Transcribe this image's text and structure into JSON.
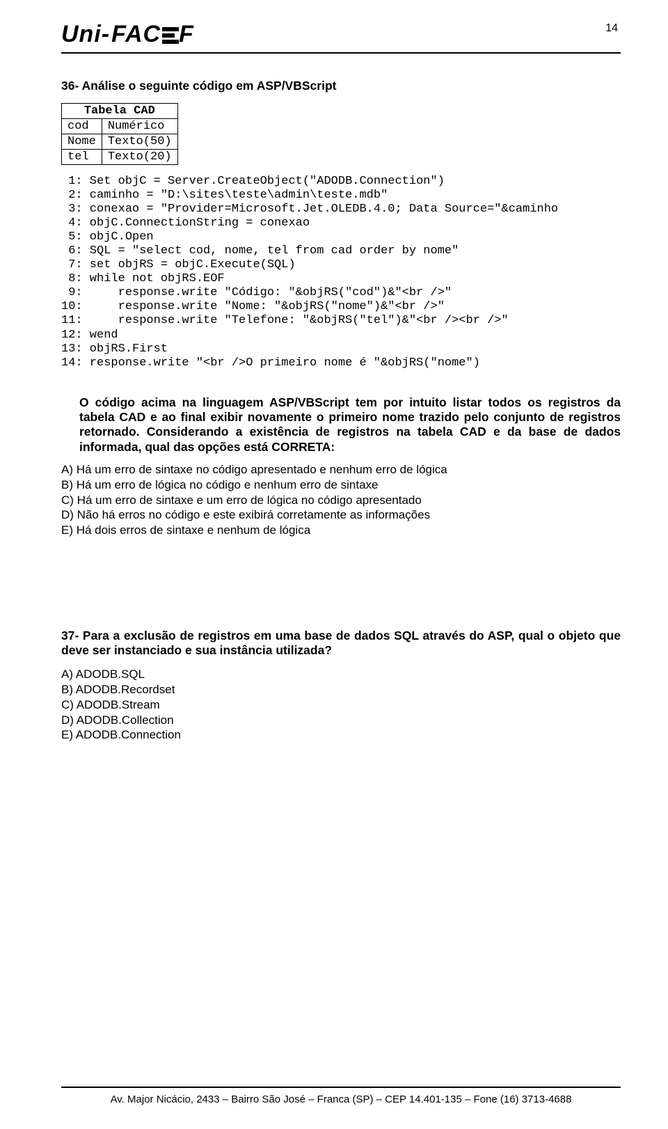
{
  "page_number": "14",
  "logo": {
    "part1": "Uni-",
    "part2": "FAC",
    "part3": "F"
  },
  "q36": {
    "title": "36- Análise o seguinte código em ASP/VBScript",
    "table": {
      "header": "Tabela CAD",
      "rows": [
        {
          "c1": "cod",
          "c2": "Numérico"
        },
        {
          "c1": "Nome",
          "c2": "Texto(50)"
        },
        {
          "c1": "tel",
          "c2": "Texto(20)"
        }
      ]
    },
    "code_lines": [
      " 1: Set objC = Server.CreateObject(\"ADODB.Connection\")",
      " 2: caminho = \"D:\\sites\\teste\\admin\\teste.mdb\"",
      " 3: conexao = \"Provider=Microsoft.Jet.OLEDB.4.0; Data Source=\"&caminho",
      " 4: objC.ConnectionString = conexao",
      " 5: objC.Open",
      " 6: SQL = \"select cod, nome, tel from cad order by nome\"",
      " 7: set objRS = objC.Execute(SQL)",
      " 8: while not objRS.EOF",
      " 9:     response.write \"Código: \"&objRS(\"cod\")&\"<br />\"",
      "10:     response.write \"Nome: \"&objRS(\"nome\")&\"<br />\"",
      "11:     response.write \"Telefone: \"&objRS(\"tel\")&\"<br /><br />\"",
      "12: wend",
      "13: objRS.First",
      "14: response.write \"<br />O primeiro nome é \"&objRS(\"nome\")"
    ],
    "desc": "O código acima na linguagem ASP/VBScript tem por intuito listar todos os registros da tabela CAD e ao final exibir novamente o primeiro nome trazido pelo conjunto de registros retornado. Considerando a existência de registros na tabela CAD e da base de dados informada, qual das opções está CORRETA:",
    "options": [
      "A)  Há um erro de sintaxe no código apresentado e nenhum erro de lógica",
      "B)  Há um erro de lógica no código e nenhum erro de sintaxe",
      "C)  Há um erro de sintaxe e um erro de lógica no código apresentado",
      "D)  Não há erros no código e este exibirá corretamente as informações",
      "E)  Há dois erros de sintaxe e nenhum de lógica"
    ]
  },
  "q37": {
    "title": "37- Para a exclusão de registros em uma base de dados SQL através do ASP, qual o objeto que deve ser instanciado e sua instância utilizada?",
    "options": [
      "A)  ADODB.SQL",
      "B)  ADODB.Recordset",
      "C)  ADODB.Stream",
      "D)  ADODB.Collection",
      "E)  ADODB.Connection"
    ]
  },
  "footer": "Av. Major Nicácio, 2433 – Bairro São José – Franca (SP) – CEP 14.401-135 – Fone (16) 3713-4688"
}
